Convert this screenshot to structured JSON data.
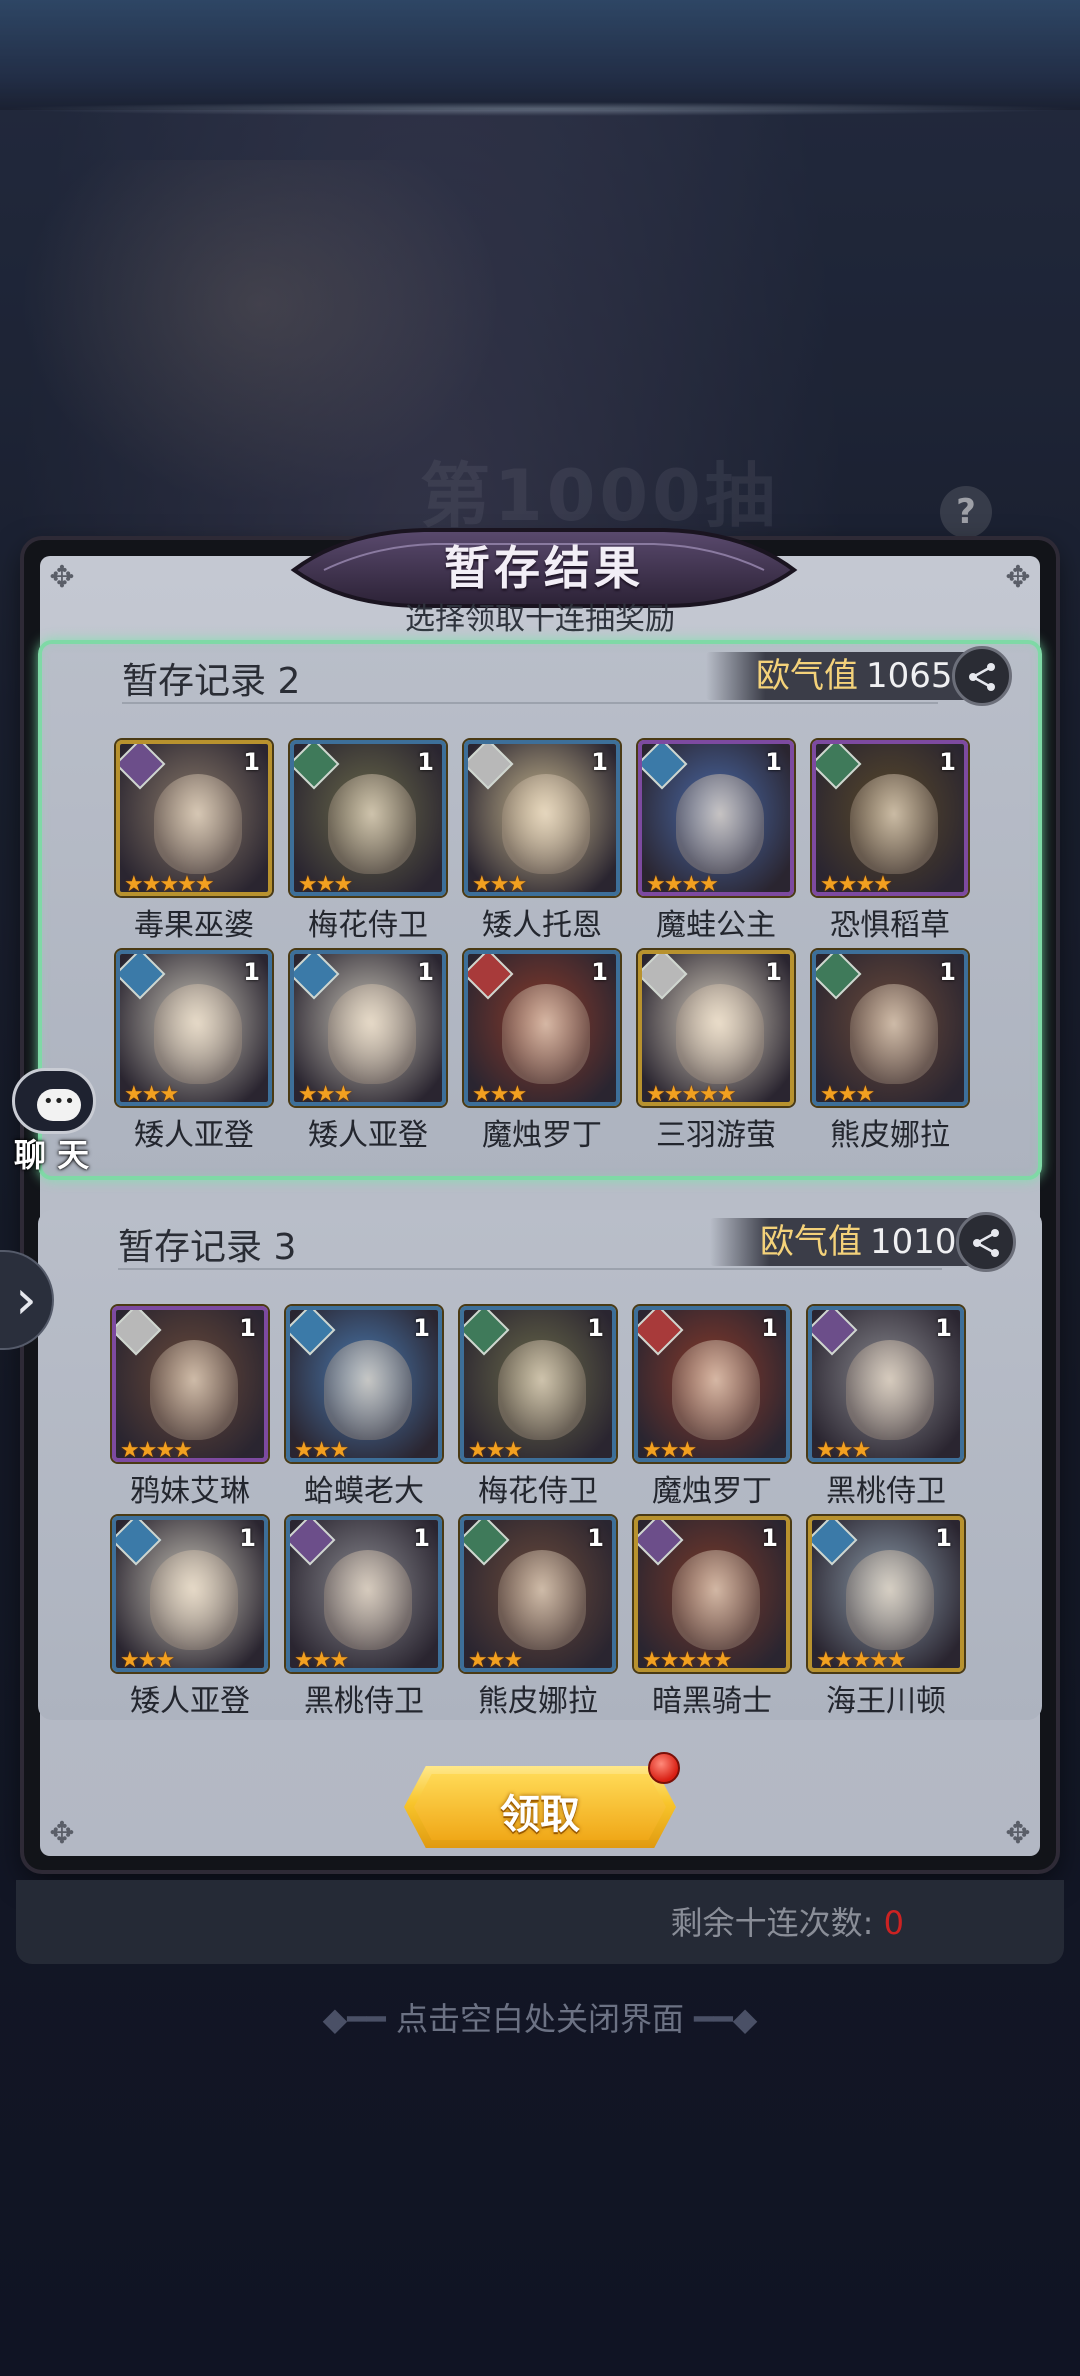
{
  "dialog": {
    "title": "暂存结果",
    "subtitle": "选择领取十连抽奖励",
    "claim_label": "领取"
  },
  "background": {
    "banner_text": "第1000抽",
    "help_label": "?"
  },
  "records": [
    {
      "title": "暂存记录 2",
      "luck_label": "欧气值",
      "luck_value": "1065",
      "selected": true,
      "heroes": [
        {
          "name": "毒果巫婆",
          "count": "1",
          "stars": 5,
          "faction": "purple",
          "frame": "gold",
          "color": "#8a7a6a"
        },
        {
          "name": "梅花侍卫",
          "count": "1",
          "stars": 3,
          "faction": "green",
          "frame": "blue",
          "color": "#6a6a4a"
        },
        {
          "name": "矮人托恩",
          "count": "1",
          "stars": 3,
          "faction": "white",
          "frame": "blue",
          "color": "#c8b890"
        },
        {
          "name": "魔蛙公主",
          "count": "1",
          "stars": 4,
          "faction": "blue",
          "frame": "purple",
          "color": "#4a6aa8"
        },
        {
          "name": "恐惧稻草",
          "count": "1",
          "stars": 4,
          "faction": "green",
          "frame": "purple",
          "color": "#5a4a2a"
        },
        {
          "name": "矮人亚登",
          "count": "1",
          "stars": 3,
          "faction": "blue",
          "frame": "blue",
          "color": "#c8c4b8"
        },
        {
          "name": "矮人亚登",
          "count": "1",
          "stars": 3,
          "faction": "blue",
          "frame": "blue",
          "color": "#c8c4b8"
        },
        {
          "name": "魔烛罗丁",
          "count": "1",
          "stars": 3,
          "faction": "red",
          "frame": "blue",
          "color": "#8a3a2a"
        },
        {
          "name": "三羽游萤",
          "count": "1",
          "stars": 5,
          "faction": "white",
          "frame": "gold",
          "color": "#d8d0c0"
        },
        {
          "name": "熊皮娜拉",
          "count": "1",
          "stars": 3,
          "faction": "green",
          "frame": "blue",
          "color": "#6a4a3a"
        }
      ]
    },
    {
      "title": "暂存记录 3",
      "luck_label": "欧气值",
      "luck_value": "1010",
      "selected": false,
      "heroes": [
        {
          "name": "鸦妹艾琳",
          "count": "1",
          "stars": 4,
          "faction": "white",
          "frame": "purple",
          "color": "#6a4a3a"
        },
        {
          "name": "蛤蟆老大",
          "count": "1",
          "stars": 3,
          "faction": "blue",
          "frame": "blue",
          "color": "#4a7ab0"
        },
        {
          "name": "梅花侍卫",
          "count": "1",
          "stars": 3,
          "faction": "green",
          "frame": "blue",
          "color": "#6a6a4a"
        },
        {
          "name": "魔烛罗丁",
          "count": "1",
          "stars": 3,
          "faction": "red",
          "frame": "blue",
          "color": "#8a3a2a"
        },
        {
          "name": "黑桃侍卫",
          "count": "1",
          "stars": 3,
          "faction": "purple",
          "frame": "blue",
          "color": "#8a8a90"
        },
        {
          "name": "矮人亚登",
          "count": "1",
          "stars": 3,
          "faction": "blue",
          "frame": "blue",
          "color": "#c8c4b8"
        },
        {
          "name": "黑桃侍卫",
          "count": "1",
          "stars": 3,
          "faction": "purple",
          "frame": "blue",
          "color": "#8a8a90"
        },
        {
          "name": "熊皮娜拉",
          "count": "1",
          "stars": 3,
          "faction": "green",
          "frame": "blue",
          "color": "#6a4a3a"
        },
        {
          "name": "暗黑骑士",
          "count": "1",
          "stars": 5,
          "faction": "purple",
          "frame": "gold",
          "color": "#7a3a2a"
        },
        {
          "name": "海王川顿",
          "count": "1",
          "stars": 5,
          "faction": "blue",
          "frame": "gold",
          "color": "#8a9aa8"
        }
      ]
    }
  ],
  "footer": {
    "remaining_label": "剩余十连次数:",
    "remaining_value": "0",
    "close_hint": "点击空白处关闭界面"
  },
  "side": {
    "chat_label": "聊 天",
    "chat_icon": "speech-bubble-icon",
    "expand_icon": "chevron-right-icon"
  },
  "colors": {
    "gold_frame": "#b8922e",
    "blue_frame": "#3d6f99",
    "purple_frame": "#7d4aa0",
    "selected_border": "#7fd9a6",
    "luck_label": "#f4d27a",
    "star": "#f2a020"
  }
}
